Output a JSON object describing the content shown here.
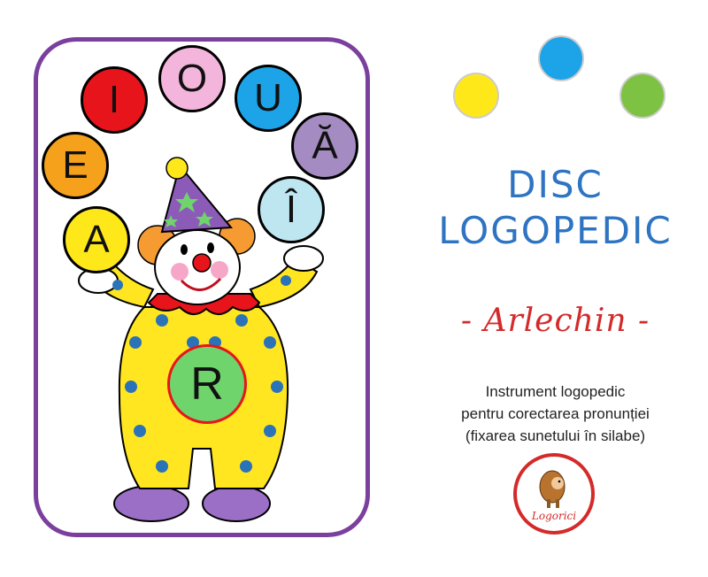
{
  "juggler_balls": [
    {
      "letter": "A",
      "color": "#ffe81a"
    },
    {
      "letter": "E",
      "color": "#f5a11c"
    },
    {
      "letter": "I",
      "color": "#e8141b"
    },
    {
      "letter": "O",
      "color": "#f4b5dc"
    },
    {
      "letter": "U",
      "color": "#1ca3e8"
    },
    {
      "letter": "Ă",
      "color": "#a48bc1"
    },
    {
      "letter": "Î",
      "color": "#bde6f0"
    }
  ],
  "center_letter": {
    "letter": "R",
    "color": "#6ed46b"
  },
  "decor_dots": [
    "#ffe81a",
    "#1ca3e8",
    "#7dc242"
  ],
  "title_line1": "DISC",
  "title_line2": "LOGOPEDIC",
  "subtitle": "- Arlechin -",
  "description": [
    "Instrument logopedic",
    "pentru corectarea pronunției",
    "(fixarea sunetului în silabe)"
  ],
  "logo_text": "Logorici",
  "colors": {
    "frame": "#7b3f9e",
    "title": "#2e74c2",
    "accent": "#d42a2a",
    "clown_body": "#ffe620",
    "clown_dots": "#2b73b8"
  }
}
